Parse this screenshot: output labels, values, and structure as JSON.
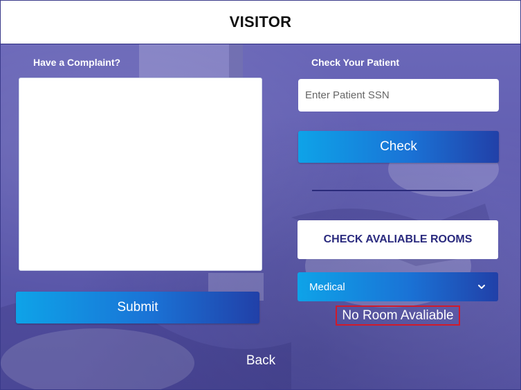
{
  "header": {
    "title": "VISITOR"
  },
  "complaint": {
    "label": "Have a Complaint?",
    "submit_label": "Submit"
  },
  "patient": {
    "label": "Check Your Patient",
    "ssn_placeholder": "Enter Patient SSN",
    "check_label": "Check"
  },
  "rooms": {
    "check_label": "CHECK AVALIABLE ROOMS",
    "selected_type": "Medical",
    "status": "No Room Avaliable"
  },
  "footer": {
    "back_label": "Back"
  }
}
